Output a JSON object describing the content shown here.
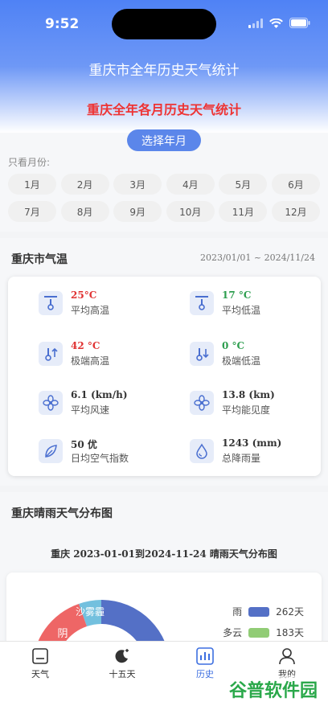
{
  "status_bar": {
    "time": "9:52"
  },
  "header": {
    "title": "重庆市全年历史天气统计",
    "subtitle": "重庆全年各月历史天气统计"
  },
  "picker": {
    "label": "选择年月",
    "only_months_label": "只看月份:"
  },
  "months": [
    "1月",
    "2月",
    "3月",
    "4月",
    "5月",
    "6月",
    "7月",
    "8月",
    "9月",
    "10月",
    "11月",
    "12月"
  ],
  "temperature": {
    "title": "重庆市气温",
    "date_range": "2023/01/01 ~ 2024/11/24",
    "stats": [
      {
        "value": "25°C",
        "label": "平均高温",
        "icon": "thermometer-icon",
        "color": "#e03232"
      },
      {
        "value": "17 °C",
        "label": "平均低温",
        "icon": "thermometer-icon",
        "color": "#2e9e4f"
      },
      {
        "value": "42 °C",
        "label": "极端高温",
        "icon": "thermometer-up-icon",
        "color": "#e03232"
      },
      {
        "value": "0 °C",
        "label": "极端低温",
        "icon": "thermometer-down-icon",
        "color": "#2e9e4f"
      },
      {
        "value": "6.1 (km/h)",
        "label": "平均风速",
        "icon": "fan-icon",
        "color": "#333333"
      },
      {
        "value": "13.8 (km)",
        "label": "平均能见度",
        "icon": "fan-icon",
        "color": "#333333"
      },
      {
        "value": "50 优",
        "label": "日均空气指数",
        "icon": "leaf-icon",
        "color": "#333333"
      },
      {
        "value": "1243 (mm)",
        "label": "总降雨量",
        "icon": "water-drop-icon",
        "color": "#333333"
      }
    ]
  },
  "distribution": {
    "title": "重庆晴雨天气分布图",
    "chart_title": "重庆 2023-01-01到2024-11-24 晴雨天气分布图",
    "slice_labels": {
      "yin": "阴",
      "fog": "沙雾霾"
    },
    "legend": [
      {
        "name": "雨",
        "value": "262天",
        "color": "#5470c6"
      },
      {
        "name": "多云",
        "value": "183天",
        "color": "#91cc75"
      }
    ]
  },
  "tabbar": {
    "items": [
      {
        "label": "天气",
        "icon": "home-icon"
      },
      {
        "label": "十五天",
        "icon": "moon-icon"
      },
      {
        "label": "历史",
        "icon": "chart-icon"
      },
      {
        "label": "我的",
        "icon": "user-icon"
      }
    ],
    "active": "历史"
  },
  "watermark": {
    "text": "谷普软件园"
  }
}
